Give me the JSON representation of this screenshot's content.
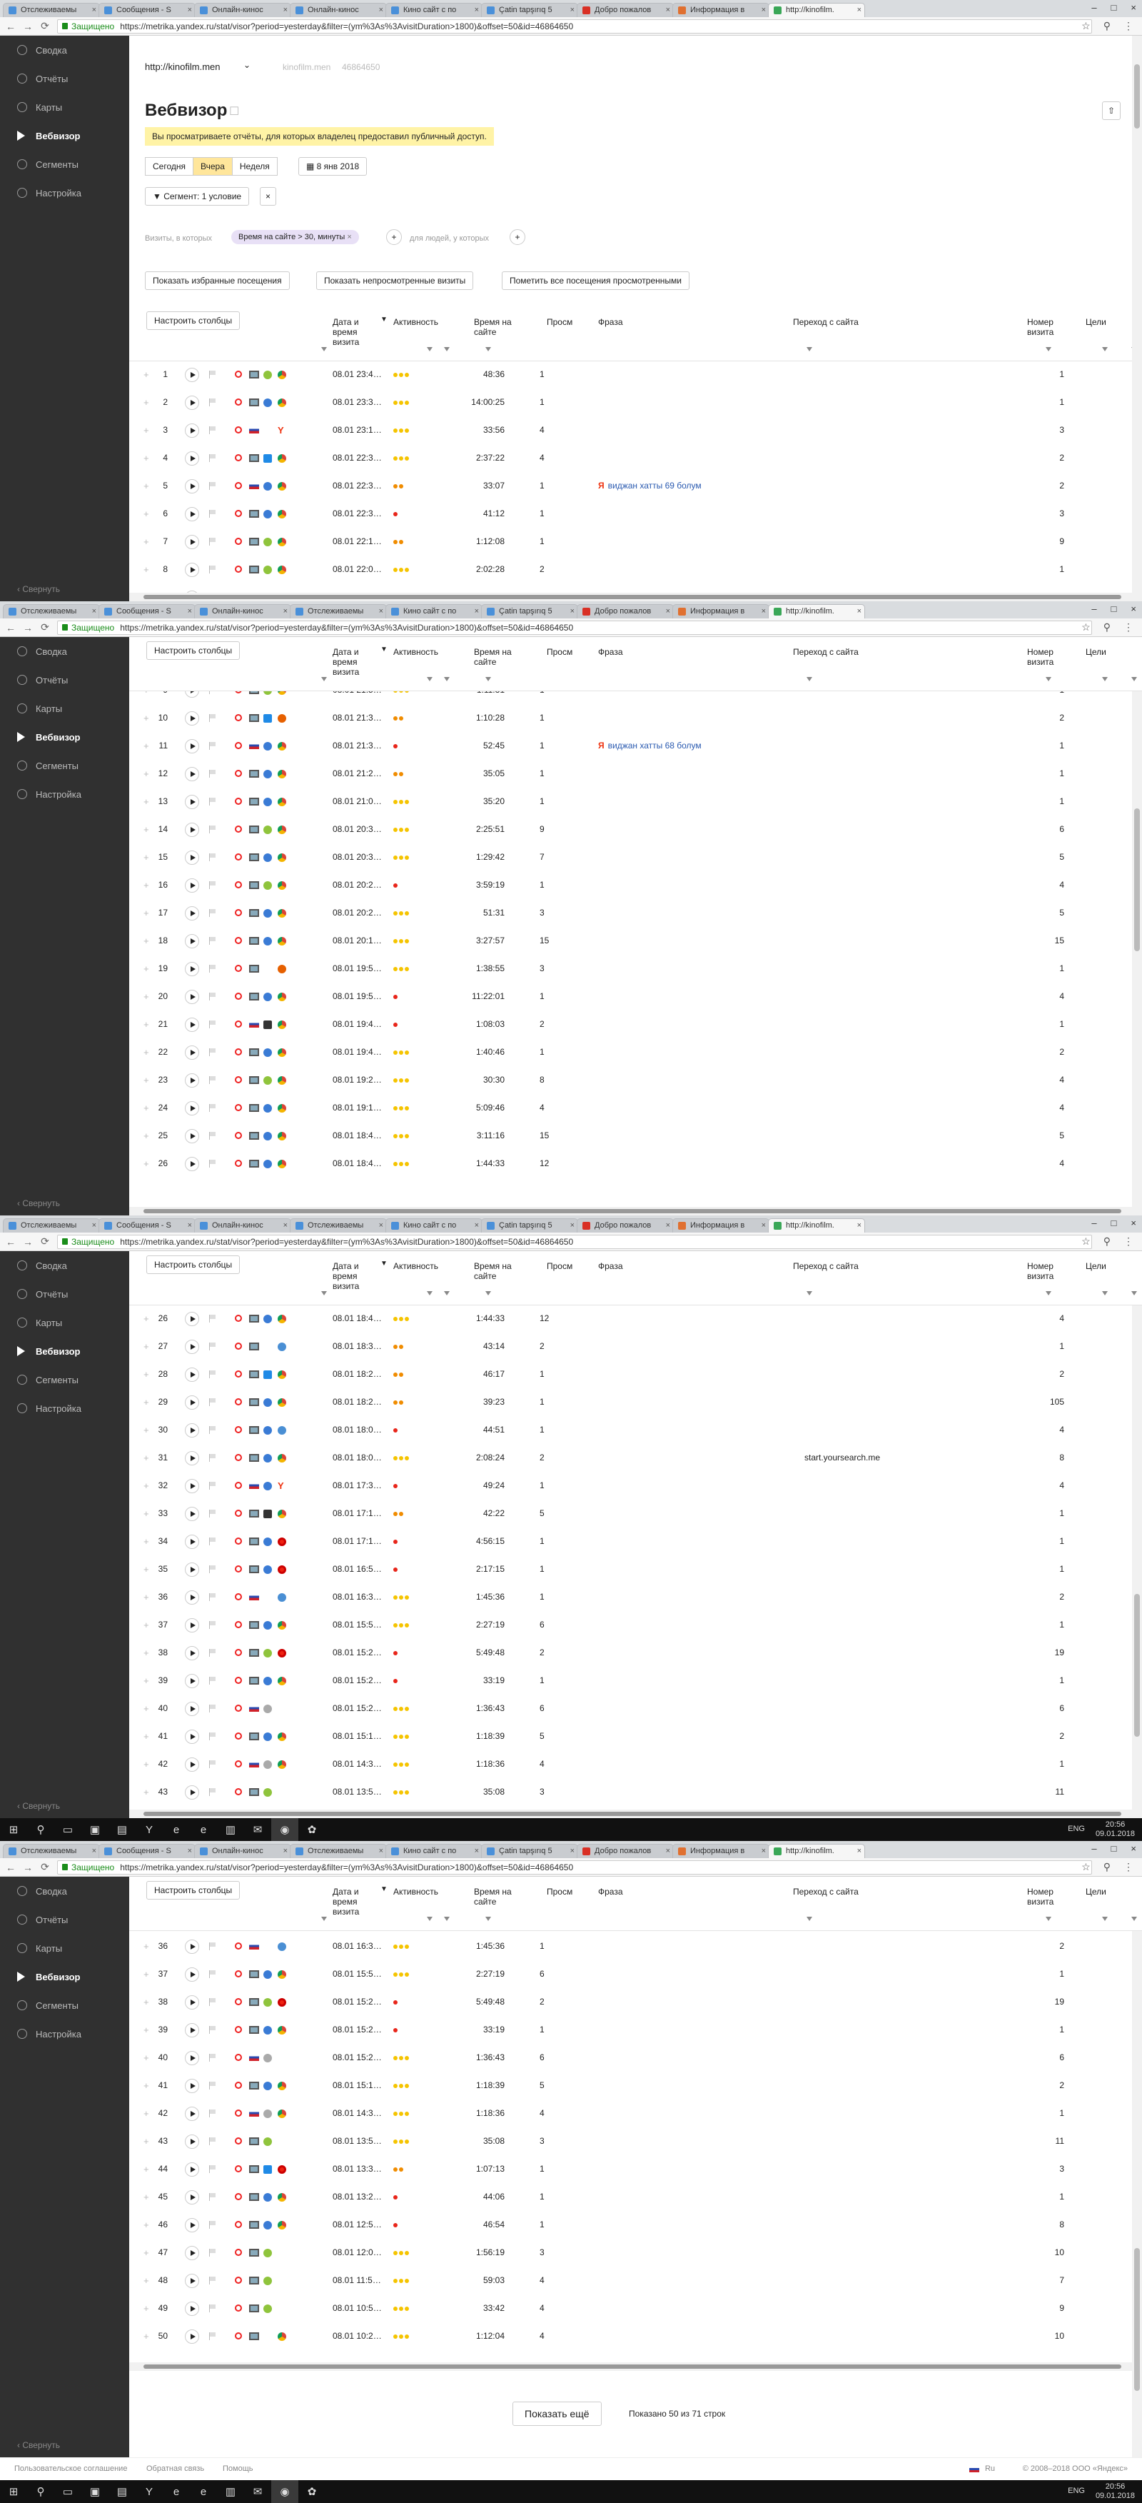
{
  "tabs": [
    {
      "label": "Отслеживаемы",
      "color": "#4a90d9"
    },
    {
      "label": "Сообщения - S",
      "color": "#4a90d9"
    },
    {
      "label": "Онлайн-кинос",
      "color": "#4a90d9"
    },
    {
      "label": "Онлайн-кинос",
      "color": "#4a90d9"
    },
    {
      "label": "Кино сайт с по",
      "color": "#4a90d9"
    },
    {
      "label": "Çatin tapşırıq 5",
      "color": "#4a90d9"
    },
    {
      "label": "Добро пожалов",
      "color": "#d93025"
    },
    {
      "label": "Информация в",
      "color": "#e07030"
    },
    {
      "label": "http://kinofilm.",
      "color": "#3aa757"
    }
  ],
  "tabs_shot2": [
    {
      "label": "Отслеживаемы",
      "color": "#4a90d9"
    },
    {
      "label": "Сообщения - S",
      "color": "#4a90d9"
    },
    {
      "label": "Онлайн-кинос",
      "color": "#4a90d9"
    },
    {
      "label": "Отслеживаемы",
      "color": "#4a90d9"
    },
    {
      "label": "Кино сайт с по",
      "color": "#4a90d9"
    },
    {
      "label": "Çatin tapşırıq 5",
      "color": "#4a90d9"
    },
    {
      "label": "Добро пожалов",
      "color": "#d93025"
    },
    {
      "label": "Информация в",
      "color": "#e07030"
    },
    {
      "label": "http://kinofilm.",
      "color": "#3aa757"
    }
  ],
  "address": {
    "secure_label": "Защищено",
    "url": "https://metrika.yandex.ru/stat/visor?period=yesterday&filter=(ym%3As%3AvisitDuration>1800)&offset=50&id=46864650"
  },
  "sidebar": {
    "items": [
      {
        "label": "Сводка"
      },
      {
        "label": "Отчёты"
      },
      {
        "label": "Карты"
      },
      {
        "label": "Вебвизор"
      },
      {
        "label": "Сегменты"
      },
      {
        "label": "Настройка"
      }
    ],
    "active_index": 3,
    "collapse_label": "Свернуть"
  },
  "header": {
    "site": "http://kinofilm.men",
    "site_muted": "kinofilm.men",
    "counter_id": "46864650",
    "title": "Вебвизор",
    "notice": "Вы просматриваете отчёты, для которых владелец предоставил публичный доступ.",
    "periods": [
      "Сегодня",
      "Вчера",
      "Неделя"
    ],
    "active_period": 1,
    "date_label": "8 янв 2018",
    "segment_label": "Сегмент: 1 условие",
    "visits_where": "Визиты, в которых",
    "filter_chip": "Время на сайте > 30, минуты",
    "for_people": "для людей, у которых",
    "show_favorites": "Показать избранные посещения",
    "show_unwatched": "Показать непросмотренные визиты",
    "mark_all_watched": "Пометить все посещения просмотренными"
  },
  "table": {
    "configure_columns": "Настроить столбцы",
    "columns": {
      "date": "Дата и время визита",
      "activity": "Активность",
      "time_on_site": "Время на сайте",
      "views": "Просм",
      "phrase": "Фраза",
      "referrer": "Переход с сайта",
      "visit_number": "Номер визита",
      "goals": "Цели"
    },
    "activity_colors": {
      "high": "#f5c400",
      "medium": "#f08c00",
      "low": "#e8251a"
    },
    "rows": [
      {
        "n": 1,
        "date": "08.01 23:4…",
        "act": 3,
        "dur": "48:36",
        "views": "1",
        "phrase": "",
        "ref": "",
        "visit": "1",
        "geo": "monitor",
        "os": "android",
        "br": "chrome"
      },
      {
        "n": 2,
        "date": "08.01 23:3…",
        "act": 3,
        "dur": "14:00:25",
        "views": "1",
        "phrase": "",
        "ref": "",
        "visit": "1",
        "geo": "monitor",
        "os": "globe",
        "br": "chrome"
      },
      {
        "n": 3,
        "date": "08.01 23:1…",
        "act": 3,
        "dur": "33:56",
        "views": "4",
        "phrase": "",
        "ref": "",
        "visit": "3",
        "geo": "flag",
        "os": "",
        "br": "yandex"
      },
      {
        "n": 4,
        "date": "08.01 22:3…",
        "act": 3,
        "dur": "2:37:22",
        "views": "4",
        "phrase": "",
        "ref": "",
        "visit": "2",
        "geo": "monitor",
        "os": "win",
        "br": "chrome"
      },
      {
        "n": 5,
        "date": "08.01 22:3…",
        "act": 2,
        "dur": "33:07",
        "views": "1",
        "phrase": "виджан хатты 69 болум",
        "ref": "",
        "visit": "2",
        "geo": "flag",
        "os": "globe",
        "br": "chrome"
      },
      {
        "n": 6,
        "date": "08.01 22:3…",
        "act": 1,
        "dur": "41:12",
        "views": "1",
        "phrase": "",
        "ref": "",
        "visit": "3",
        "geo": "monitor",
        "os": "globe",
        "br": "chrome"
      },
      {
        "n": 7,
        "date": "08.01 22:1…",
        "act": 2,
        "dur": "1:12:08",
        "views": "1",
        "phrase": "",
        "ref": "",
        "visit": "9",
        "geo": "monitor",
        "os": "android",
        "br": "chrome"
      },
      {
        "n": 8,
        "date": "08.01 22:0…",
        "act": 3,
        "dur": "2:02:28",
        "views": "2",
        "phrase": "",
        "ref": "",
        "visit": "1",
        "geo": "monitor",
        "os": "android",
        "br": "chrome"
      },
      {
        "n": 9,
        "date": "08.01 21:5…",
        "act": 3,
        "dur": "1:11:31",
        "views": "1",
        "phrase": "",
        "ref": "",
        "visit": "1",
        "geo": "monitor",
        "os": "android",
        "br": "chrome"
      },
      {
        "n": 10,
        "date": "08.01 21:3…",
        "act": 2,
        "dur": "1:10:28",
        "views": "1",
        "phrase": "",
        "ref": "",
        "visit": "2",
        "geo": "monitor",
        "os": "win",
        "br": "firefox"
      },
      {
        "n": 11,
        "date": "08.01 21:3…",
        "act": 1,
        "dur": "52:45",
        "views": "1",
        "phrase": "виджан хатты 68 болум",
        "ref": "",
        "visit": "1",
        "geo": "flag",
        "os": "globe",
        "br": "chrome"
      },
      {
        "n": 12,
        "date": "08.01 21:2…",
        "act": 2,
        "dur": "35:05",
        "views": "1",
        "phrase": "",
        "ref": "",
        "visit": "1",
        "geo": "monitor",
        "os": "globe",
        "br": "chrome"
      },
      {
        "n": 13,
        "date": "08.01 21:0…",
        "act": 3,
        "dur": "35:20",
        "views": "1",
        "phrase": "",
        "ref": "",
        "visit": "1",
        "geo": "monitor",
        "os": "globe",
        "br": "chrome"
      },
      {
        "n": 14,
        "date": "08.01 20:3…",
        "act": 3,
        "dur": "2:25:51",
        "views": "9",
        "phrase": "",
        "ref": "",
        "visit": "6",
        "geo": "monitor",
        "os": "android",
        "br": "chrome"
      },
      {
        "n": 15,
        "date": "08.01 20:3…",
        "act": 3,
        "dur": "1:29:42",
        "views": "7",
        "phrase": "",
        "ref": "",
        "visit": "5",
        "geo": "monitor",
        "os": "globe",
        "br": "chrome"
      },
      {
        "n": 16,
        "date": "08.01 20:2…",
        "act": 1,
        "dur": "3:59:19",
        "views": "1",
        "phrase": "",
        "ref": "",
        "visit": "4",
        "geo": "monitor",
        "os": "android",
        "br": "chrome"
      },
      {
        "n": 17,
        "date": "08.01 20:2…",
        "act": 3,
        "dur": "51:31",
        "views": "3",
        "phrase": "",
        "ref": "",
        "visit": "5",
        "geo": "monitor",
        "os": "globe",
        "br": "chrome"
      },
      {
        "n": 18,
        "date": "08.01 20:1…",
        "act": 3,
        "dur": "3:27:57",
        "views": "15",
        "phrase": "",
        "ref": "",
        "visit": "15",
        "geo": "monitor",
        "os": "globe",
        "br": "chrome"
      },
      {
        "n": 19,
        "date": "08.01 19:5…",
        "act": 3,
        "dur": "1:38:55",
        "views": "3",
        "phrase": "",
        "ref": "",
        "visit": "1",
        "geo": "monitor",
        "os": "",
        "br": "firefox"
      },
      {
        "n": 20,
        "date": "08.01 19:5…",
        "act": 1,
        "dur": "11:22:01",
        "views": "1",
        "phrase": "",
        "ref": "",
        "visit": "4",
        "geo": "monitor",
        "os": "globe",
        "br": "chrome"
      },
      {
        "n": 21,
        "date": "08.01 19:4…",
        "act": 1,
        "dur": "1:08:03",
        "views": "2",
        "phrase": "",
        "ref": "",
        "visit": "1",
        "geo": "flag",
        "os": "linux",
        "br": "chrome"
      },
      {
        "n": 22,
        "date": "08.01 19:4…",
        "act": 3,
        "dur": "1:40:46",
        "views": "1",
        "phrase": "",
        "ref": "",
        "visit": "2",
        "geo": "monitor",
        "os": "globe",
        "br": "chrome"
      },
      {
        "n": 23,
        "date": "08.01 19:2…",
        "act": 3,
        "dur": "30:30",
        "views": "8",
        "phrase": "",
        "ref": "",
        "visit": "4",
        "geo": "monitor",
        "os": "android",
        "br": "chrome"
      },
      {
        "n": 24,
        "date": "08.01 19:1…",
        "act": 3,
        "dur": "5:09:46",
        "views": "4",
        "phrase": "",
        "ref": "",
        "visit": "4",
        "geo": "monitor",
        "os": "globe",
        "br": "chrome"
      },
      {
        "n": 25,
        "date": "08.01 18:4…",
        "act": 3,
        "dur": "3:11:16",
        "views": "15",
        "phrase": "",
        "ref": "",
        "visit": "5",
        "geo": "monitor",
        "os": "globe",
        "br": "chrome"
      },
      {
        "n": 26,
        "date": "08.01 18:4…",
        "act": 3,
        "dur": "1:44:33",
        "views": "12",
        "phrase": "",
        "ref": "",
        "visit": "4",
        "geo": "monitor",
        "os": "globe",
        "br": "chrome"
      },
      {
        "n": 27,
        "date": "08.01 18:3…",
        "act": 2,
        "dur": "43:14",
        "views": "2",
        "phrase": "",
        "ref": "",
        "visit": "1",
        "geo": "monitor",
        "os": "",
        "br": "globe"
      },
      {
        "n": 28,
        "date": "08.01 18:2…",
        "act": 2,
        "dur": "46:17",
        "views": "1",
        "phrase": "",
        "ref": "",
        "visit": "2",
        "geo": "monitor",
        "os": "win",
        "br": "chrome"
      },
      {
        "n": 29,
        "date": "08.01 18:2…",
        "act": 2,
        "dur": "39:23",
        "views": "1",
        "phrase": "",
        "ref": "",
        "visit": "105",
        "geo": "monitor",
        "os": "globe",
        "br": "chrome"
      },
      {
        "n": 30,
        "date": "08.01 18:0…",
        "act": 1,
        "dur": "44:51",
        "views": "1",
        "phrase": "",
        "ref": "",
        "visit": "4",
        "geo": "monitor",
        "os": "globe",
        "br": "globe"
      },
      {
        "n": 31,
        "date": "08.01 18:0…",
        "act": 3,
        "dur": "2:08:24",
        "views": "2",
        "phrase": "",
        "ref": "start.yoursearch.me",
        "visit": "8",
        "geo": "monitor",
        "os": "globe",
        "br": "chrome"
      },
      {
        "n": 32,
        "date": "08.01 17:3…",
        "act": 1,
        "dur": "49:24",
        "views": "1",
        "phrase": "",
        "ref": "",
        "visit": "4",
        "geo": "flag",
        "os": "globe",
        "br": "yandex"
      },
      {
        "n": 33,
        "date": "08.01 17:1…",
        "act": 2,
        "dur": "42:22",
        "views": "5",
        "phrase": "",
        "ref": "",
        "visit": "1",
        "geo": "monitor",
        "os": "linux",
        "br": "chrome"
      },
      {
        "n": 34,
        "date": "08.01 17:1…",
        "act": 1,
        "dur": "4:56:15",
        "views": "1",
        "phrase": "",
        "ref": "",
        "visit": "1",
        "geo": "monitor",
        "os": "globe",
        "br": "opera"
      },
      {
        "n": 35,
        "date": "08.01 16:5…",
        "act": 1,
        "dur": "2:17:15",
        "views": "1",
        "phrase": "",
        "ref": "",
        "visit": "1",
        "geo": "monitor",
        "os": "globe",
        "br": "opera"
      },
      {
        "n": 36,
        "date": "08.01 16:3…",
        "act": 3,
        "dur": "1:45:36",
        "views": "1",
        "phrase": "",
        "ref": "",
        "visit": "2",
        "geo": "flag",
        "os": "",
        "br": "globe"
      },
      {
        "n": 37,
        "date": "08.01 15:5…",
        "act": 3,
        "dur": "2:27:19",
        "views": "6",
        "phrase": "",
        "ref": "",
        "visit": "1",
        "geo": "monitor",
        "os": "globe",
        "br": "chrome"
      },
      {
        "n": 38,
        "date": "08.01 15:2…",
        "act": 1,
        "dur": "5:49:48",
        "views": "2",
        "phrase": "",
        "ref": "",
        "visit": "19",
        "geo": "monitor",
        "os": "android",
        "br": "opera"
      },
      {
        "n": 39,
        "date": "08.01 15:2…",
        "act": 1,
        "dur": "33:19",
        "views": "1",
        "phrase": "",
        "ref": "",
        "visit": "1",
        "geo": "monitor",
        "os": "globe",
        "br": "chrome"
      },
      {
        "n": 40,
        "date": "08.01 15:2…",
        "act": 3,
        "dur": "1:36:43",
        "views": "6",
        "phrase": "",
        "ref": "",
        "visit": "6",
        "geo": "flag",
        "os": "apple",
        "br": ""
      },
      {
        "n": 41,
        "date": "08.01 15:1…",
        "act": 3,
        "dur": "1:18:39",
        "views": "5",
        "phrase": "",
        "ref": "",
        "visit": "2",
        "geo": "monitor",
        "os": "globe",
        "br": "chrome"
      },
      {
        "n": 42,
        "date": "08.01 14:3…",
        "act": 3,
        "dur": "1:18:36",
        "views": "4",
        "phrase": "",
        "ref": "",
        "visit": "1",
        "geo": "flag",
        "os": "apple",
        "br": "chrome"
      },
      {
        "n": 43,
        "date": "08.01 13:5…",
        "act": 3,
        "dur": "35:08",
        "views": "3",
        "phrase": "",
        "ref": "",
        "visit": "11",
        "geo": "monitor",
        "os": "android",
        "br": ""
      },
      {
        "n": 44,
        "date": "08.01 13:3…",
        "act": 2,
        "dur": "1:07:13",
        "views": "1",
        "phrase": "",
        "ref": "",
        "visit": "3",
        "geo": "monitor",
        "os": "win",
        "br": "opera"
      },
      {
        "n": 45,
        "date": "08.01 13:2…",
        "act": 1,
        "dur": "44:06",
        "views": "1",
        "phrase": "",
        "ref": "",
        "visit": "1",
        "geo": "monitor",
        "os": "globe",
        "br": "chrome"
      },
      {
        "n": 46,
        "date": "08.01 12:5…",
        "act": 1,
        "dur": "46:54",
        "views": "1",
        "phrase": "",
        "ref": "",
        "visit": "8",
        "geo": "monitor",
        "os": "globe",
        "br": "chrome"
      },
      {
        "n": 47,
        "date": "08.01 12:0…",
        "act": 3,
        "dur": "1:56:19",
        "views": "3",
        "phrase": "",
        "ref": "",
        "visit": "10",
        "geo": "monitor",
        "os": "android",
        "br": ""
      },
      {
        "n": 48,
        "date": "08.01 11:5…",
        "act": 3,
        "dur": "59:03",
        "views": "4",
        "phrase": "",
        "ref": "",
        "visit": "7",
        "geo": "monitor",
        "os": "android",
        "br": ""
      },
      {
        "n": 49,
        "date": "08.01 10:5…",
        "act": 3,
        "dur": "33:42",
        "views": "4",
        "phrase": "",
        "ref": "",
        "visit": "9",
        "geo": "monitor",
        "os": "android",
        "br": ""
      },
      {
        "n": 50,
        "date": "08.01 10:2…",
        "act": 3,
        "dur": "1:12:04",
        "views": "4",
        "phrase": "",
        "ref": "",
        "visit": "10",
        "geo": "monitor",
        "os": "",
        "br": "chrome"
      }
    ]
  },
  "pager": {
    "show_more": "Показать ещё",
    "shown_text": "Показано 50 из 71 строк"
  },
  "footer": {
    "links": [
      "Пользовательское соглашение",
      "Обратная связь",
      "Помощь"
    ],
    "lang": "Ru",
    "copyright": "© 2008–2018 ООО «Яндекс»"
  },
  "taskbar": {
    "lang": "ENG",
    "time": "20:56",
    "date": "09.01.2018"
  }
}
